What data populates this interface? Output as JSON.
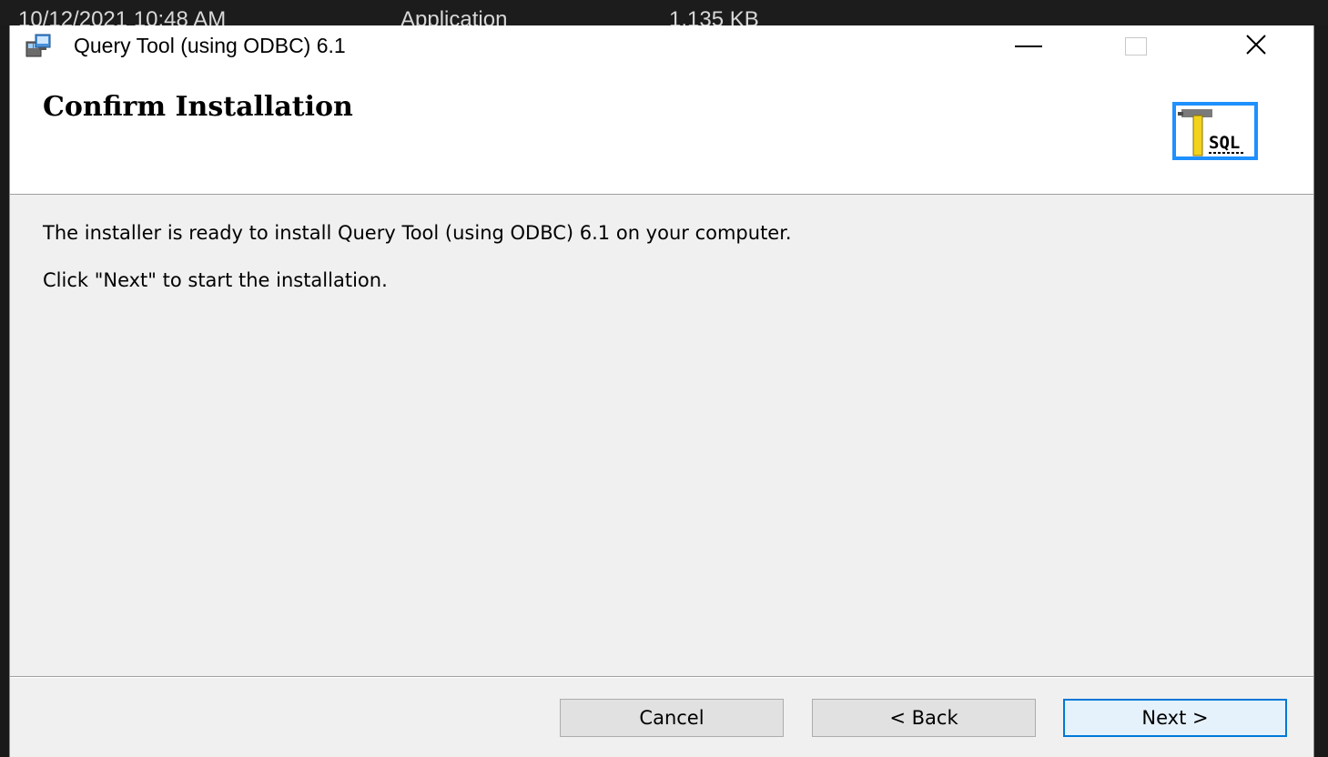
{
  "background_window": {
    "date_text": "10/12/2021 10:48 AM",
    "type_text": "Application",
    "size_text": "1,135 KB"
  },
  "titlebar": {
    "app_icon": "installer-icon",
    "title": "Query Tool (using ODBC) 6.1",
    "minimize_icon": "minimize-icon",
    "maximize_icon": "maximize-icon",
    "close_icon": "close-icon",
    "close_glyph": "✕"
  },
  "banner": {
    "title": "Confirm Installation",
    "icon": "sql-hammer-icon",
    "icon_label": "SQL"
  },
  "content": {
    "line1": "The installer is ready to install Query Tool (using ODBC) 6.1 on your computer.",
    "line2": "Click \"Next\" to start the installation."
  },
  "footer": {
    "cancel_label": "Cancel",
    "back_label": "< Back",
    "next_label": "Next >"
  },
  "colors": {
    "window_bg": "#f0f0f0",
    "header_bg": "#ffffff",
    "default_button_border": "#0078d7",
    "sql_icon_blue": "#1e90ff"
  }
}
